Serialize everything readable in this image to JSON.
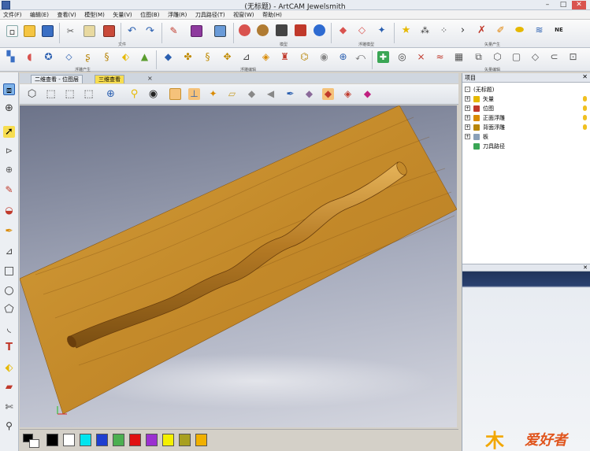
{
  "window": {
    "title": "(无标题) - ArtCAM Jewelsmith",
    "min": "–",
    "max": "□",
    "close": "✕"
  },
  "menu": [
    "文件(F)",
    "编辑(E)",
    "查看(V)",
    "模型(M)",
    "矢量(V)",
    "位图(B)",
    "浮雕(R)",
    "刀具路径(T)",
    "视窗(W)",
    "帮助(H)"
  ],
  "toolbar_groups": {
    "file": "文件",
    "model": "模型",
    "relief_model": "浮雕模型",
    "vector_create": "矢量产生",
    "relief_create": "浮雕产生",
    "relief_edit": "浮雕编辑",
    "vector_edit": "矢量编辑"
  },
  "tabs": [
    {
      "label": "二维查看 - 位图层"
    },
    {
      "label": "三维查看"
    }
  ],
  "tab_close": "×",
  "project_panel": {
    "title": "项目",
    "close": "✕",
    "tree": [
      {
        "label": "(无标题)"
      },
      {
        "label": "矢量"
      },
      {
        "label": "位图"
      },
      {
        "label": "正面浮雕"
      },
      {
        "label": "背面浮雕"
      },
      {
        "label": "板"
      },
      {
        "label": "刀具路径"
      }
    ]
  },
  "lower_panel": {
    "close": "✕"
  },
  "palette": {
    "colors": [
      "#000000",
      "#ffffff",
      "#00e5ee",
      "#1f3fd0",
      "#4caf50",
      "#e01010",
      "#9b30d0",
      "#f4f000",
      "#a8a020",
      "#f0b000"
    ]
  },
  "logo": {
    "text": "爱好者"
  },
  "colors": {
    "accent": "#f7dd50",
    "wood": "#c8922e"
  }
}
